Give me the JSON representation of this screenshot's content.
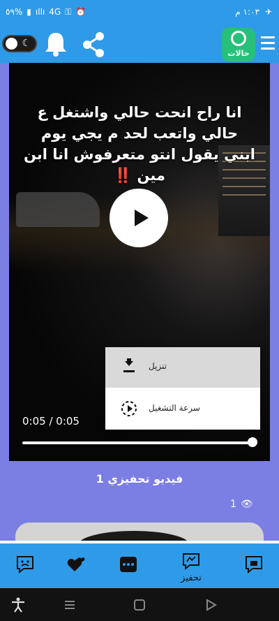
{
  "status_bar": {
    "time": "١:٠٣ م",
    "battery": "٥٩%",
    "network": "4G"
  },
  "app_bar": {
    "logo_text": "حالات",
    "icons": [
      "dark-mode-toggle",
      "bell-icon",
      "share-icon",
      "menu-icon"
    ]
  },
  "video": {
    "overlay_text": "انا راح انحت حالي واشتغل ع حالي واتعب لحد م يجي يوم ابني يقول انتو متعرفوش انا ابن مين ‼️",
    "time_display": "0:05 / 0:05",
    "progress": 1.0
  },
  "popup_menu": {
    "items": [
      {
        "label": "تنزيل",
        "icon": "download-icon"
      },
      {
        "label": "سرعة التشغيل",
        "icon": "playback-speed-icon"
      }
    ]
  },
  "card": {
    "title": "فيديو تحفيزي 1",
    "views": "1"
  },
  "bottom_nav": {
    "items": [
      {
        "icon": "sad-face-icon",
        "label": ""
      },
      {
        "icon": "hearts-icon",
        "label": ""
      },
      {
        "icon": "more-icon",
        "label": ""
      },
      {
        "icon": "motivation-icon",
        "label": "تحفيز"
      },
      {
        "icon": "cards-icon",
        "label": ""
      }
    ]
  },
  "colors": {
    "primary": "#2f9be8",
    "card": "#7b7ee2",
    "logo": "#27c07a"
  }
}
